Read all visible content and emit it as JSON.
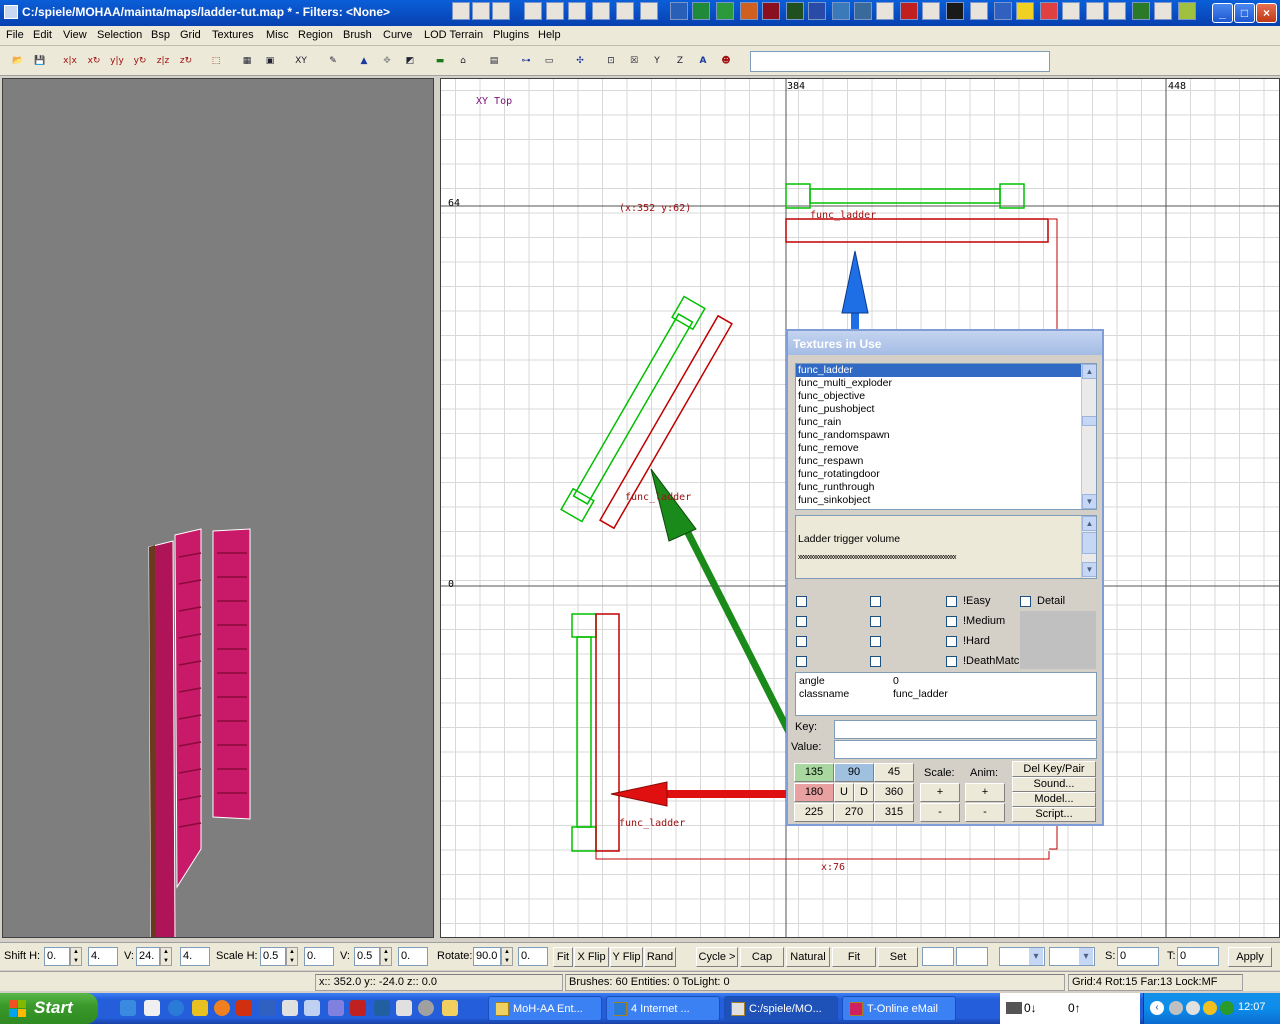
{
  "window": {
    "title": "C:/spiele/MOHAA/mainta/maps/ladder-tut.map * - Filters: <None>",
    "minimize": "_",
    "maximize": "□",
    "close": "×"
  },
  "menu": [
    "File",
    "Edit",
    "View",
    "Selection",
    "Bsp",
    "Grid",
    "Textures",
    "Misc",
    "Region",
    "Brush",
    "Curve",
    "LOD Terrain",
    "Plugins",
    "Help"
  ],
  "toolbar": {
    "tools": [
      "open-icon",
      "save-icon",
      "flip-x-icon",
      "rotate-x-icon",
      "flip-y-icon",
      "rotate-y-icon",
      "flip-z-icon",
      "rotate-z-icon",
      "select-complete-icon",
      "select-touching-icon",
      "select-inside-icon",
      "csg-subtract-icon",
      "csg-merge-icon",
      "clipper-icon",
      "view-switch-icon",
      "texture-icon",
      "free-rotate-icon",
      "drag-edges-icon",
      "scale-icon",
      "entity-icon",
      "patch-icon",
      "camera-icon",
      "plugin-x-icon",
      "plugin-y-icon",
      "plugin-z-icon",
      "font-a-icon",
      "shader-icon"
    ],
    "command_value": ""
  },
  "xy_view": {
    "view_label": "XY Top",
    "axis_x": [
      "384",
      "448"
    ],
    "axis_y": [
      "64",
      "0"
    ],
    "coord_label": "(x:352 y:62)",
    "dimension_label": "x:76",
    "entity_labels": [
      "func_ladder",
      "func_ladder",
      "func_ladder"
    ]
  },
  "texture_dialog": {
    "title": "Textures in Use",
    "class_list": [
      "func_ladder",
      "func_multi_exploder",
      "func_objective",
      "func_pushobject",
      "func_rain",
      "func_randomspawn",
      "func_remove",
      "func_respawn",
      "func_rotatingdoor",
      "func_runthrough",
      "func_sinkobject"
    ],
    "selected_index": 0,
    "description": "Ladder trigger volume",
    "description_rule": "xxxxxxxxxxxxxxxxxxxxxxxxxxxxxxxxxxxxxxxxxxxxxxxxxxxxxxxxxxxxxxx",
    "spawnflags": [
      "!Easy",
      "!Medium",
      "!Hard",
      "!DeathMatc"
    ],
    "detail_label": "Detail",
    "properties": [
      {
        "key": "angle",
        "value": "0"
      },
      {
        "key": "classname",
        "value": "func_ladder"
      }
    ],
    "key_label": "Key:",
    "value_label": "Value:",
    "key_value": "",
    "value_value": "",
    "angles": [
      "135",
      "90",
      "45",
      "180",
      "U",
      "D",
      "360",
      "225",
      "270",
      "315"
    ],
    "scale_label": "Scale:",
    "anim_label": "Anim:",
    "plus": "+",
    "minus": "-",
    "actions": [
      "Del Key/Pair",
      "Sound...",
      "Model...",
      "Script..."
    ]
  },
  "bottom_bar": {
    "shift_label": "Shift  H:",
    "shift_h": "0.",
    "shift_h2": "4.",
    "v_label": "V:",
    "shift_v": "24.",
    "shift_v2": "4.",
    "scale_label": "Scale  H:",
    "scale_h": "0.5",
    "scale_h2": "0.",
    "scale_v_label": "V:",
    "scale_v": "0.5",
    "scale_v2": "0.",
    "rotate_label": "Rotate:",
    "rotate": "90.0",
    "rotate2": "0.",
    "buttons": [
      "Fit",
      "X Flip",
      "Y Flip",
      "Rand",
      "Cycle >",
      "Cap",
      "Natural",
      "Fit",
      "Set"
    ],
    "s_label": "S:",
    "s_value": "0",
    "t_label": "T:",
    "t_value": "0",
    "apply": "Apply"
  },
  "status": {
    "coords": "x:: 352.0  y:: -24.0  z:: 0.0",
    "counts": "Brushes: 60 Entities: 0 ToLight: 0",
    "grid": "Grid:4 Rot:15 Far:13 Lock:MF"
  },
  "taskbar": {
    "start": "Start",
    "tasks": [
      "MoH-AA Ent...",
      "4 Internet ...",
      "C:/spiele/MO...",
      "T-Online eMail"
    ],
    "active_task": 2,
    "mid_panel_a": "0↓",
    "mid_panel_b": "0↑",
    "clock": "12:07"
  },
  "colors": {
    "selection_green": "#00c000",
    "entity_red": "#c00000",
    "arrow_green": "#1a8a1a",
    "arrow_blue": "#1e6fe6",
    "arrow_red": "#e01010"
  }
}
